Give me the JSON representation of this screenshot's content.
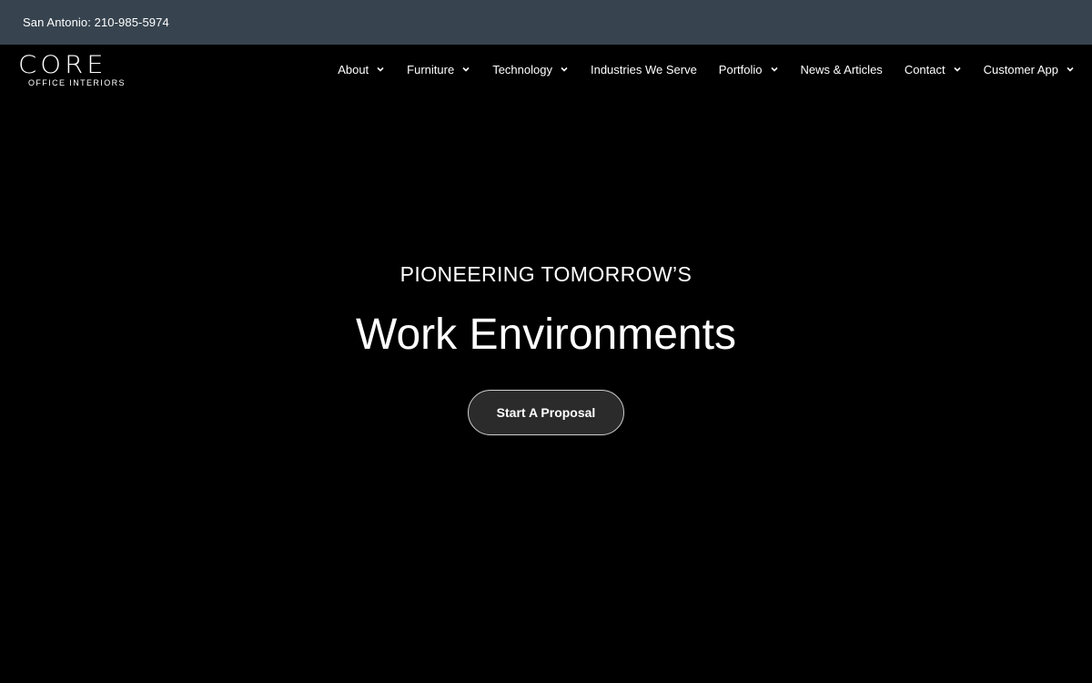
{
  "topbar": {
    "phone_text": "San Antonio: 210-985-5974"
  },
  "logo": {
    "word": "CORE",
    "subtitle": "OFFICE INTERIORS"
  },
  "nav": {
    "items": [
      {
        "label": "About",
        "has_dropdown": true
      },
      {
        "label": "Furniture",
        "has_dropdown": true
      },
      {
        "label": "Technology",
        "has_dropdown": true
      },
      {
        "label": "Industries We Serve",
        "has_dropdown": false
      },
      {
        "label": "Portfolio",
        "has_dropdown": true
      },
      {
        "label": "News & Articles",
        "has_dropdown": false
      },
      {
        "label": "Contact",
        "has_dropdown": true
      },
      {
        "label": "Customer App",
        "has_dropdown": true
      }
    ]
  },
  "hero": {
    "kicker": "PIONEERING TOMORROW’S",
    "title": "Work Environments",
    "cta_label": "Start A Proposal"
  },
  "colors": {
    "topbar_bg": "#37444f",
    "page_bg": "#000000",
    "cta_bg": "#2b2b2b",
    "text": "#ffffff"
  },
  "icons": {
    "dropdown": "chevron-down-icon"
  }
}
